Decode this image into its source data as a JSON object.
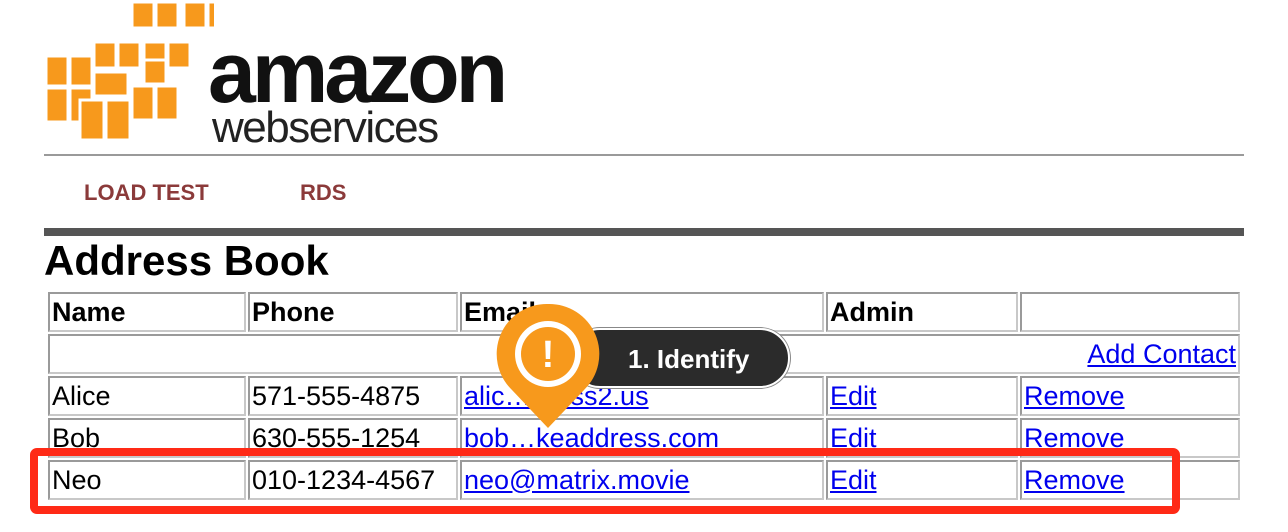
{
  "logo": {
    "line1": "amazon",
    "line2": "webservices",
    "accent": "#f7991c"
  },
  "nav": {
    "items": [
      {
        "label": "LOAD TEST"
      },
      {
        "label": "RDS"
      }
    ],
    "color": "#8b3a3a"
  },
  "page": {
    "title": "Address Book"
  },
  "table": {
    "headers": {
      "name": "Name",
      "phone": "Phone",
      "email": "Email",
      "admin": "Admin"
    },
    "add_contact": "Add Contact",
    "rows": [
      {
        "name": "Alice",
        "phone": "571-555-4875",
        "email": "alic…dress2.us",
        "edit": "Edit",
        "remove": "Remove"
      },
      {
        "name": "Bob",
        "phone": "630-555-1254",
        "email": "bob…keaddress.com",
        "edit": "Edit",
        "remove": "Remove"
      },
      {
        "name": "Neo",
        "phone": "010-1234-4567",
        "email": "neo@matrix.movie",
        "edit": "Edit",
        "remove": "Remove"
      }
    ]
  },
  "annotation": {
    "step_label": "1. Identify",
    "marker_glyph": "!",
    "marker_color": "#f7991c",
    "highlight_color": "#ff2a16"
  }
}
